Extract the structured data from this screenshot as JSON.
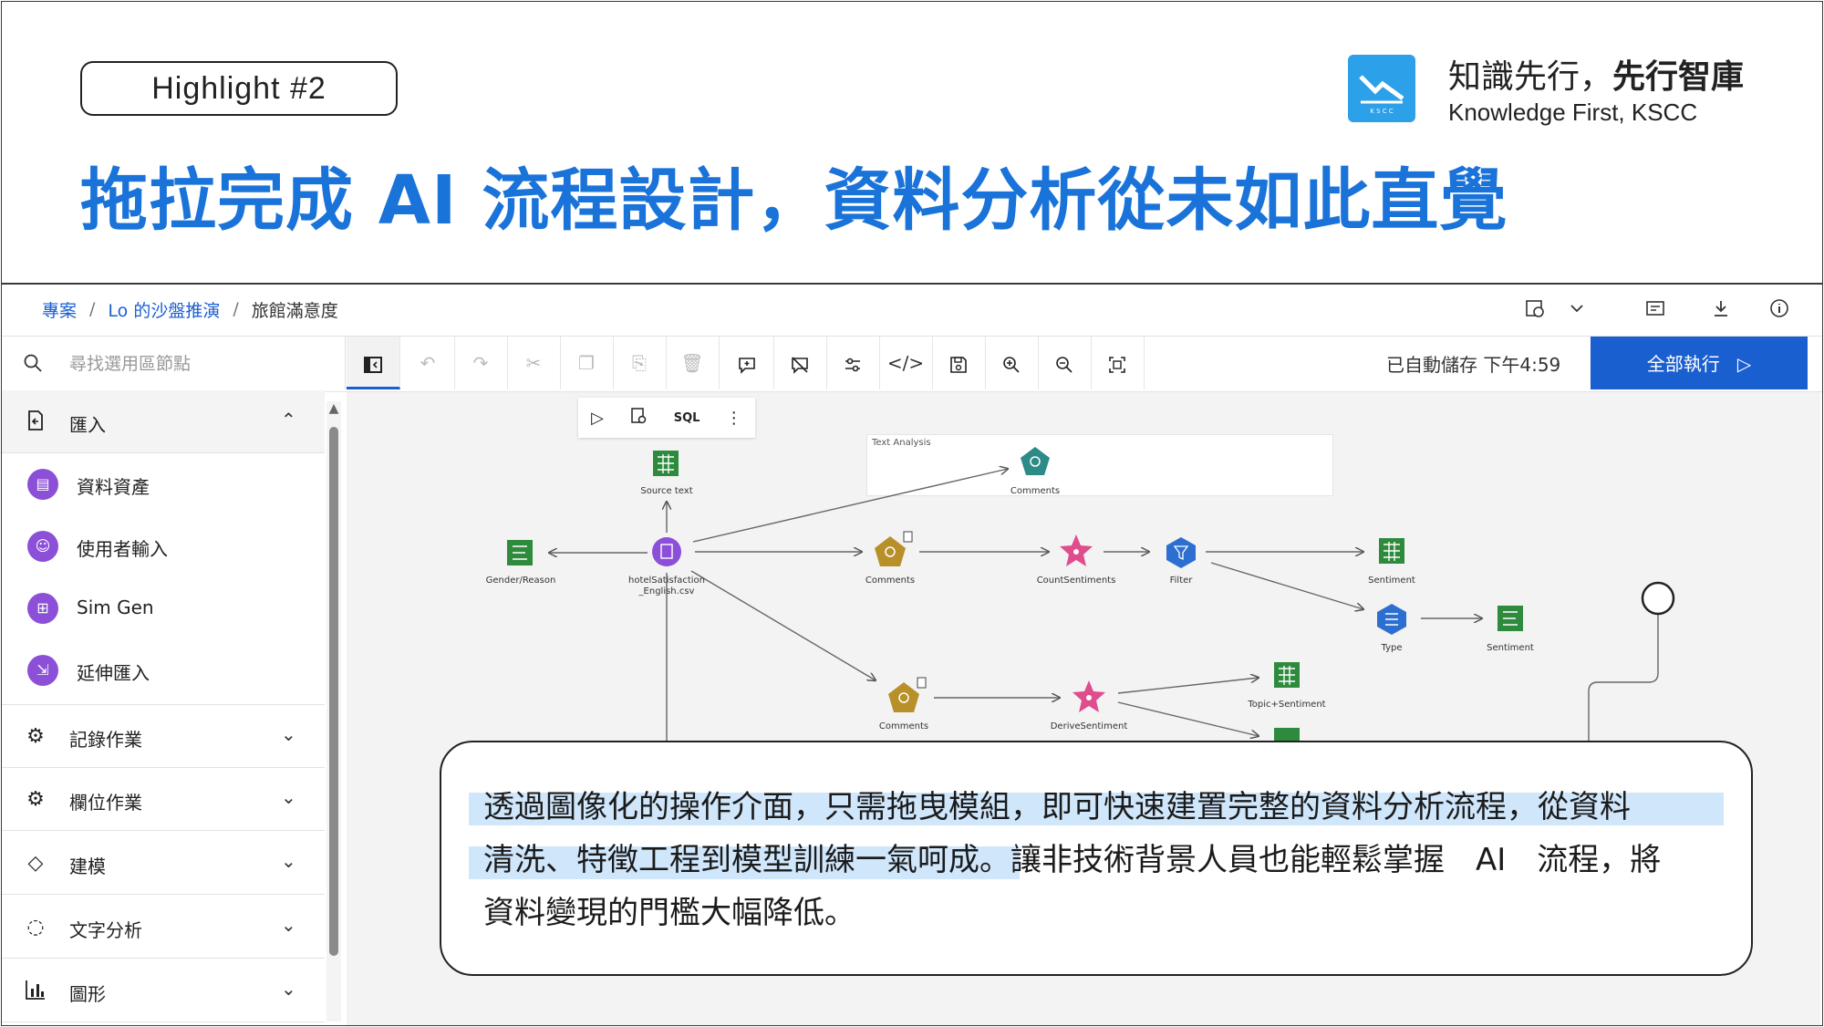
{
  "header": {
    "badge": "Highlight #2",
    "headline": "拖拉完成 AI 流程設計，資料分析從未如此直覺",
    "brand_zh_plain": "知識先行，",
    "brand_zh_bold": "先行智庫",
    "brand_en": "Knowledge First, KSCC",
    "logo_text": "K S C C"
  },
  "app": {
    "breadcrumb": {
      "project": "專案",
      "sandbox": "Lo 的沙盤推演",
      "current": "旅館滿意度",
      "separator": "/"
    },
    "top_icons": [
      "schedule-icon",
      "chevron-down-icon",
      "settings-icon",
      "download-icon",
      "info-icon"
    ],
    "search": {
      "placeholder": "尋找選用區節點"
    },
    "toolbar": {
      "autosave": "已自動儲存 下午4:59",
      "run_all": "全部執行"
    },
    "node_toolbar": {
      "sql": "SQL"
    },
    "sidebar": {
      "import_section": "匯入",
      "import_items": [
        {
          "label": "資料資產",
          "icon": "data-asset-icon"
        },
        {
          "label": "使用者輸入",
          "icon": "user-input-icon"
        },
        {
          "label": "Sim Gen",
          "icon": "sim-gen-icon"
        },
        {
          "label": "延伸匯入",
          "icon": "extension-import-icon"
        }
      ],
      "sections": [
        {
          "label": "記錄作業",
          "icon": "record-ops-icon"
        },
        {
          "label": "欄位作業",
          "icon": "field-ops-icon"
        },
        {
          "label": "建模",
          "icon": "modeling-icon"
        },
        {
          "label": "文字分析",
          "icon": "text-analysis-icon"
        },
        {
          "label": "圖形",
          "icon": "graph-icon"
        }
      ]
    },
    "flow": {
      "group_label": "Text Analysis",
      "nodes": {
        "source_text": "Source text",
        "comments_top": "Comments",
        "gender": "Gender/Reason",
        "hotel_line1": "hotelSatisfaction",
        "hotel_line2": "_English.csv",
        "comments_mid": "Comments",
        "count_sent": "CountSentiments",
        "filter": "Filter",
        "sentiment1": "Sentiment",
        "type": "Type",
        "sentiment2": "Sentiment",
        "comments_low": "Comments",
        "derive_sent": "DeriveSentiment",
        "topic_sent": "Topic+Sentiment"
      }
    }
  },
  "callout": {
    "line1": "透過圖像化的操作介面，只需拖曳模組，即可快速建置完整的資料分析流程，從資料",
    "line2": "清洗、特徵工程到模型訓練一氣呵成。讓非技術背景人員也能輕鬆掌握　AI　流程，將",
    "line3": "資料變現的門檻大幅降低。"
  },
  "colors": {
    "headline": "#1a73d9",
    "run_button": "#1a5fd0",
    "node_green": "#2e8b3e",
    "node_purple": "#8c4fd8",
    "node_gold": "#b8902a",
    "node_pink": "#e04d8f",
    "node_blue": "#2d6fd1",
    "node_teal": "#2e8a86",
    "highlight": "#cfe6fb"
  }
}
